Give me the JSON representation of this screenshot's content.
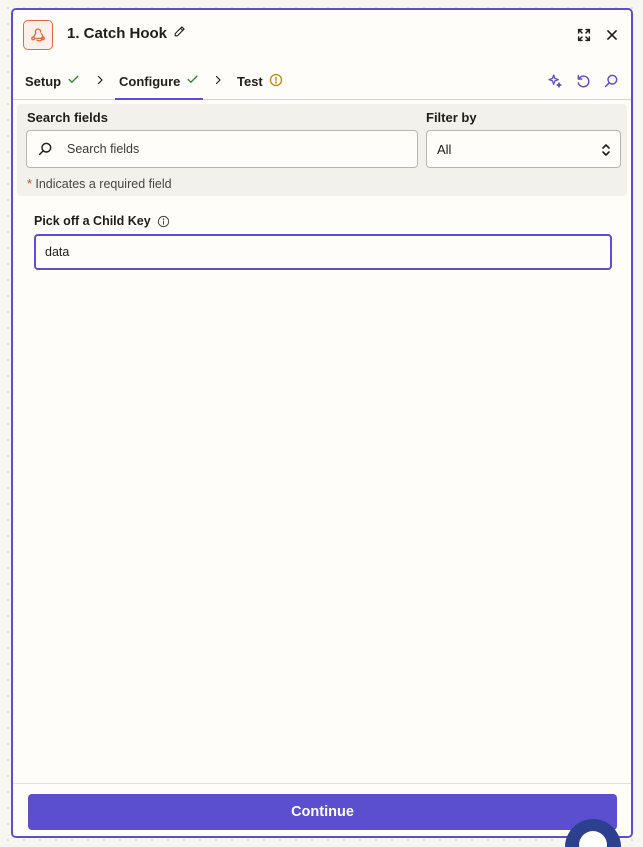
{
  "header": {
    "title": "1. Catch Hook",
    "icons": {
      "app": "webhook-icon",
      "edit": "pencil-icon",
      "expand": "expand-icon",
      "close": "close-icon"
    }
  },
  "tabs": [
    {
      "label": "Setup",
      "status": "check-icon"
    },
    {
      "label": "Configure",
      "status": "check-icon",
      "active": true
    },
    {
      "label": "Test",
      "status": "warning-icon"
    }
  ],
  "tools": [
    "sparkle-icon",
    "undo-icon",
    "search-icon"
  ],
  "filters": {
    "search_label": "Search fields",
    "search_placeholder": "Search fields",
    "filter_label": "Filter by",
    "filter_value": "All",
    "required_star": "*",
    "required_note": "Indicates a required field"
  },
  "field": {
    "label": "Pick off a Child Key",
    "value": "data"
  },
  "footer": {
    "continue_label": "Continue"
  },
  "colors": {
    "accent": "#5b4fcf",
    "brand_orange": "#e56a3c",
    "success": "#2e8b3a",
    "warning": "#b8860b"
  }
}
